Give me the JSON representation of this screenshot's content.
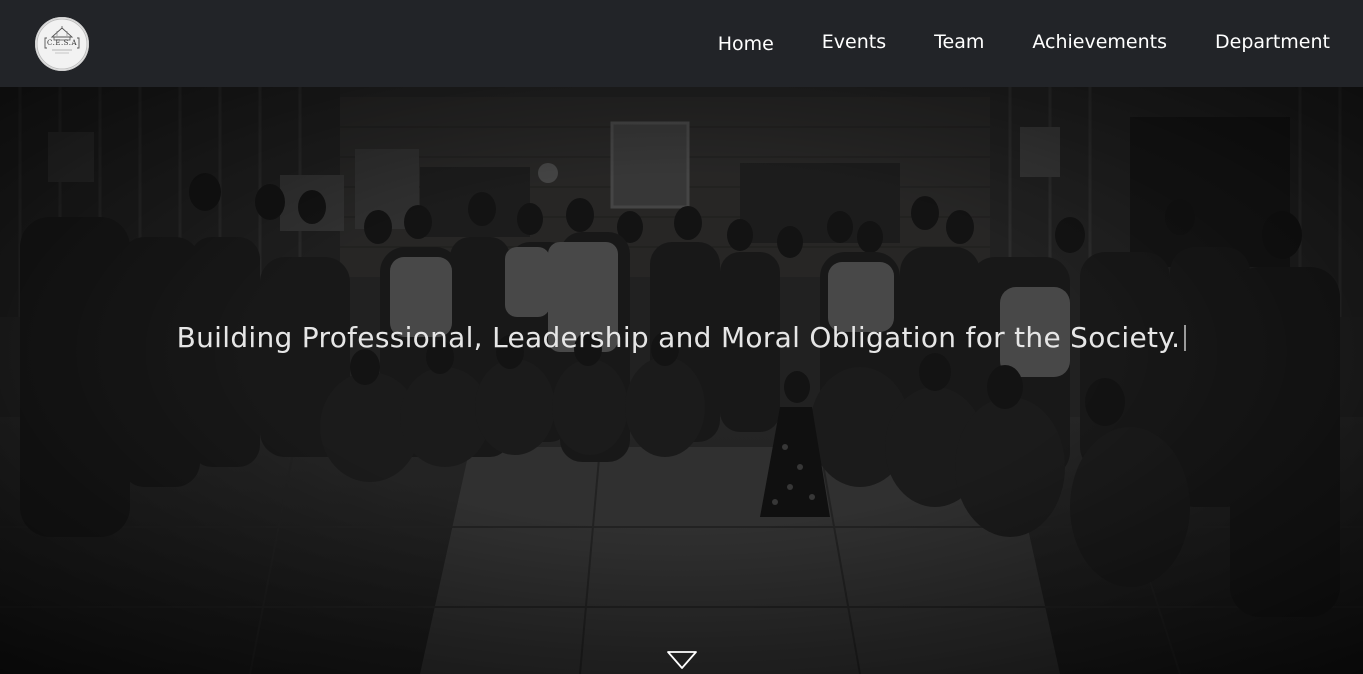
{
  "brand": {
    "logo_text": "C.E.S.A",
    "logo_name": "cesa-logo"
  },
  "nav": {
    "items": [
      {
        "label": "Home"
      },
      {
        "label": "Events"
      },
      {
        "label": "Team"
      },
      {
        "label": "Achievements"
      },
      {
        "label": "Department"
      }
    ]
  },
  "hero": {
    "tagline": "Building Professional, Leadership and Moral Obligation for the Society.",
    "scroll_icon": "chevron-down-triangle-icon"
  },
  "colors": {
    "navbar_bg": "#222428",
    "nav_text": "#ffffff",
    "tagline_text": "#e6e6e6"
  }
}
